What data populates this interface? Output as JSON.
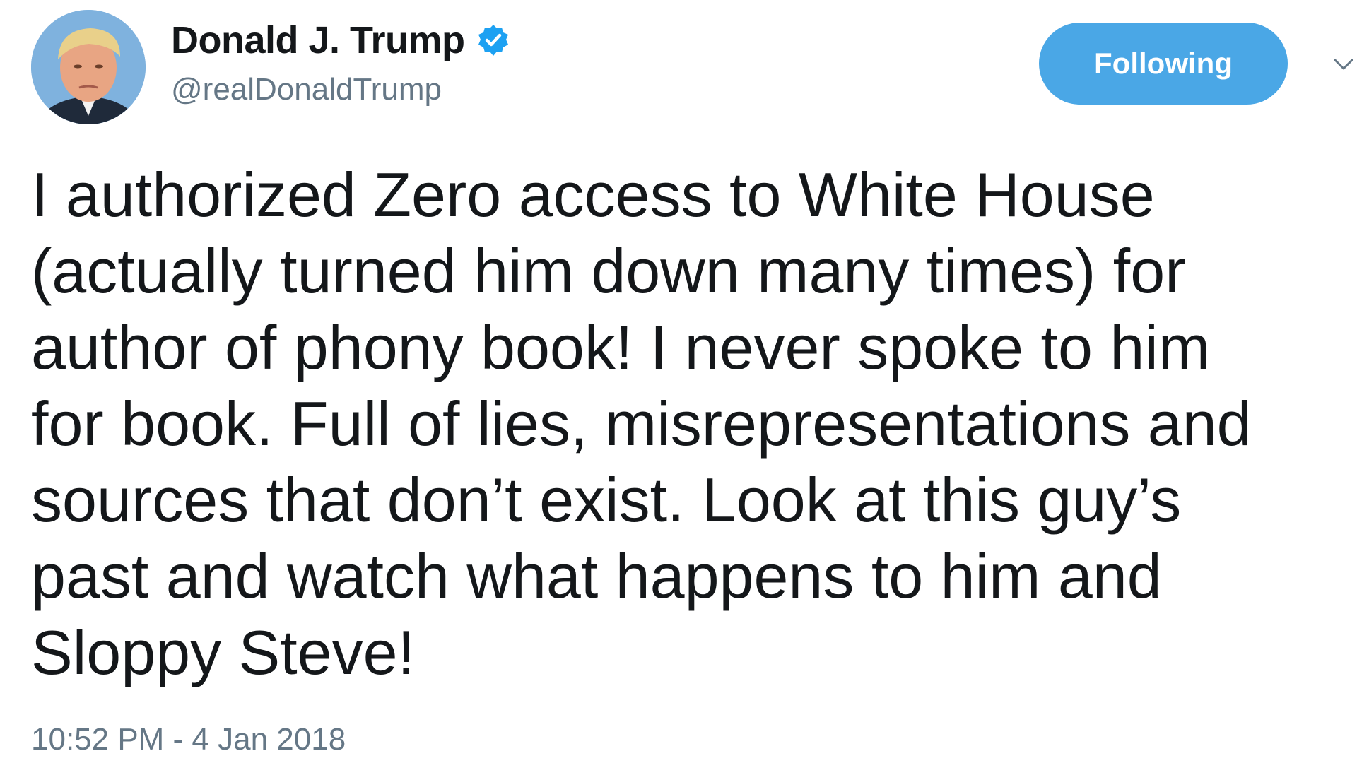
{
  "author": {
    "display_name": "Donald J. Trump",
    "handle": "@realDonaldTrump",
    "verified": true,
    "avatar_icon": "profile-photo"
  },
  "actions": {
    "follow_label": "Following",
    "menu_icon": "chevron-down-icon"
  },
  "tweet": {
    "lines": [
      "I authorized Zero access to White House",
      "(actually turned him down many times) for",
      "author of phony book! I never spoke to him",
      "for book. Full of lies, misrepresentations and",
      "sources that don’t exist. Look at this guy’s",
      "past and watch what happens to him and",
      "Sloppy Steve!"
    ],
    "timestamp": "10:52 PM - 4 Jan 2018"
  },
  "colors": {
    "accent": "#4aa7e6",
    "verified_badge": "#1da1f2",
    "text_primary": "#14171a",
    "text_secondary": "#657786",
    "background": "#ffffff"
  }
}
